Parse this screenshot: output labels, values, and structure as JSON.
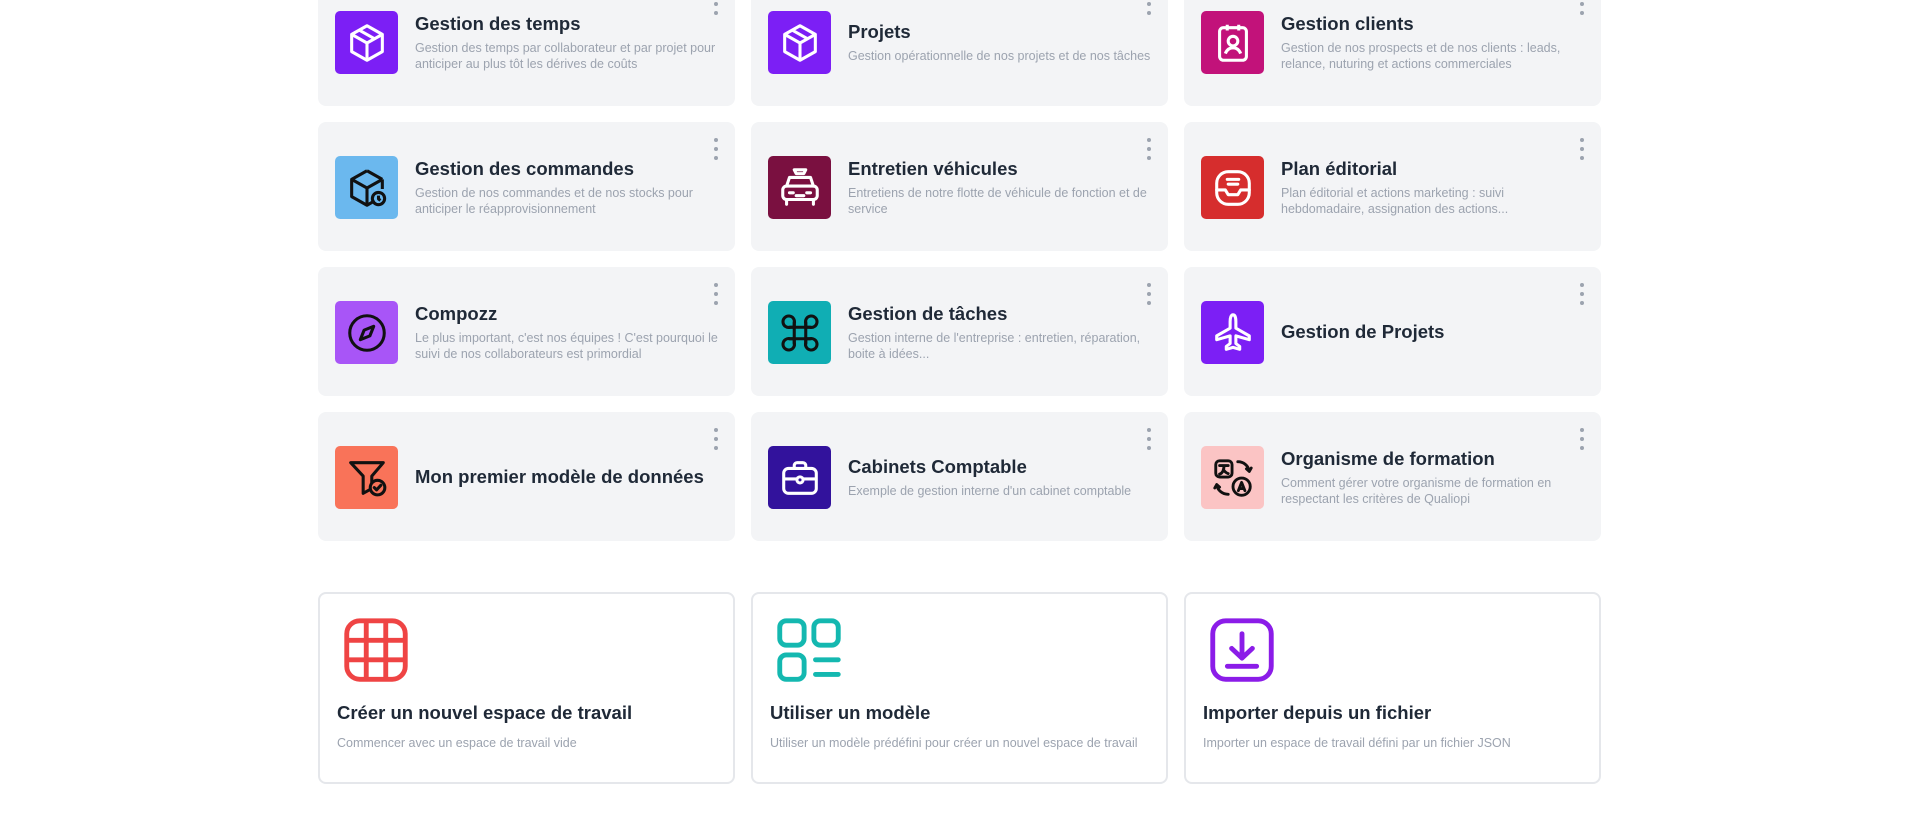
{
  "workspaces": [
    {
      "title": "Gestion des temps",
      "description": "Gestion des temps par collaborateur et par projet pour anticiper au plus tôt les dérives de coûts",
      "icon": "cube-icon",
      "color": "#7c1ff5"
    },
    {
      "title": "Projets",
      "description": "Gestion opérationnelle de nos projets et de nos tâches",
      "icon": "cube-icon",
      "color": "#7c1ff5"
    },
    {
      "title": "Gestion clients",
      "description": "Gestion de nos prospects et de nos clients : leads, relance, nuturing et actions commerciales",
      "icon": "contact-badge-icon",
      "color": "#c2127a"
    },
    {
      "title": "Gestion des commandes",
      "description": "Gestion de nos commandes et de nos stocks pour anticiper le réapprovisionnement",
      "icon": "package-clock-icon",
      "color": "#6bb8ee"
    },
    {
      "title": "Entretien véhicules",
      "description": "Entretiens de notre flotte de véhicule de fonction et de service",
      "icon": "car-icon",
      "color": "#7a1040"
    },
    {
      "title": "Plan éditorial",
      "description": "Plan éditorial et actions marketing : suivi hebdomadaire, assignation des actions...",
      "icon": "inbox-icon",
      "color": "#d62d2d"
    },
    {
      "title": "Compozz",
      "description": "Le plus important, c'est nos équipes ! C'est pourquoi le suivi de nos collaborateurs est primordial",
      "icon": "compass-icon",
      "color": "#a855f7"
    },
    {
      "title": "Gestion de tâches",
      "description": "Gestion interne de l'entreprise : entretien, réparation, boite à idées...",
      "icon": "command-icon",
      "color": "#10aeb4"
    },
    {
      "title": "Gestion de Projets",
      "description": "",
      "icon": "plane-icon",
      "color": "#7c1ff5"
    },
    {
      "title": "Mon premier modèle de données",
      "description": "",
      "icon": "funnel-check-icon",
      "color": "#f97359"
    },
    {
      "title": "Cabinets Comptable",
      "description": "Exemple de gestion interne d'un cabinet comptable",
      "icon": "briefcase-icon",
      "color": "#32129c"
    },
    {
      "title": "Organisme de formation",
      "description": "Comment gérer votre organisme de formation en respectant les critères de Qualiopi",
      "icon": "translate-icon",
      "color": "#fbc4c4"
    }
  ],
  "actions": [
    {
      "title": "Créer un nouvel espace de travail",
      "description": "Commencer avec un espace de travail vide",
      "icon": "grid-icon",
      "color": "#ef4444"
    },
    {
      "title": "Utiliser un modèle",
      "description": "Utiliser un modèle prédéfini pour créer un nouvel espace de travail",
      "icon": "template-icon",
      "color": "#14b8b0"
    },
    {
      "title": "Importer depuis un fichier",
      "description": "Importer un espace de travail défini par un fichier JSON",
      "icon": "import-icon",
      "color": "#8b1ce8"
    }
  ]
}
